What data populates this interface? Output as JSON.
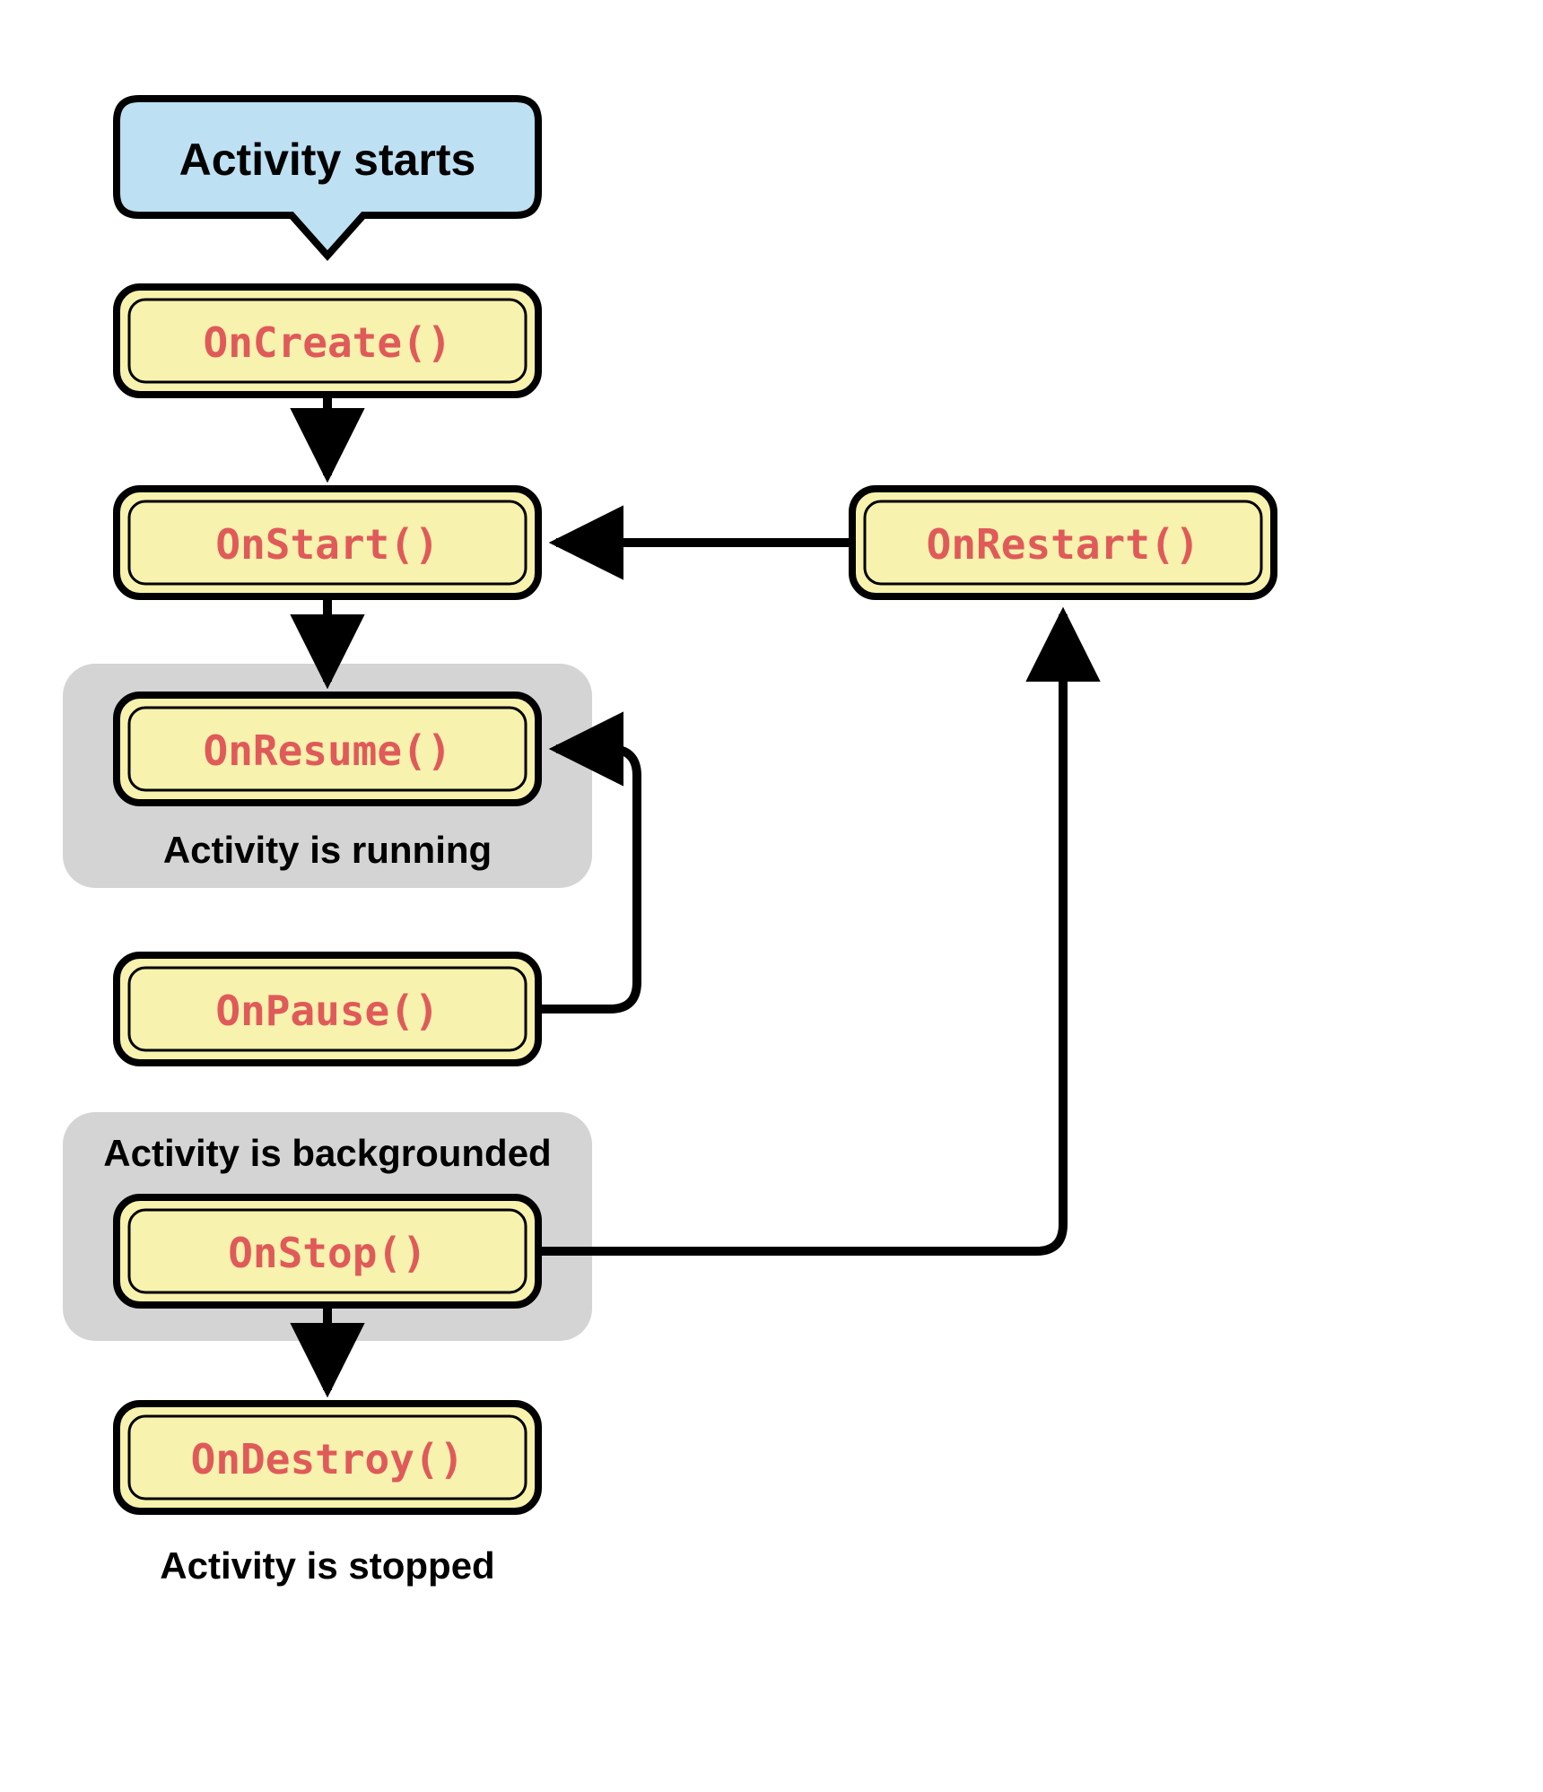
{
  "nodes": {
    "start": {
      "label": "Activity starts"
    },
    "oncreate": {
      "label": "OnCreate()"
    },
    "onstart": {
      "label": "OnStart()"
    },
    "onresume": {
      "label": "OnResume()"
    },
    "onpause": {
      "label": "OnPause()"
    },
    "onstop": {
      "label": "OnStop()"
    },
    "ondestroy": {
      "label": "OnDestroy()"
    },
    "onrestart": {
      "label": "OnRestart()"
    }
  },
  "captions": {
    "running": "Activity is running",
    "backgrounded": "Activity is backgrounded",
    "stopped": "Activity is stopped"
  },
  "colors": {
    "startFill": "#bde0f2",
    "methodFill": "#f7f2ad",
    "groupFill": "#d4d4d4",
    "methodText": "#e05a5a",
    "stroke": "#000000"
  }
}
